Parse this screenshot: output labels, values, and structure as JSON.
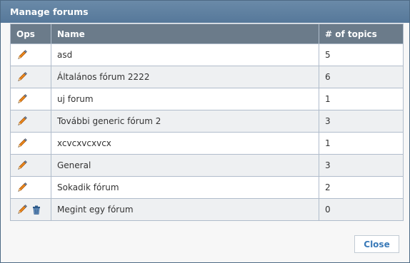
{
  "dialog": {
    "title": "Manage forums",
    "close_label": "Close"
  },
  "table": {
    "headers": [
      "Ops",
      "Name",
      "# of topics"
    ],
    "rows": [
      {
        "name": "asd",
        "topics": "5",
        "deletable": false
      },
      {
        "name": "Általános fórum 2222",
        "topics": "6",
        "deletable": false
      },
      {
        "name": "uj forum",
        "topics": "1",
        "deletable": false
      },
      {
        "name": "További generic fórum 2",
        "topics": "3",
        "deletable": false
      },
      {
        "name": "xcvcxvcxvcx",
        "topics": "1",
        "deletable": false
      },
      {
        "name": "General",
        "topics": "3",
        "deletable": false
      },
      {
        "name": "Sokadik fórum",
        "topics": "2",
        "deletable": false
      },
      {
        "name": "Megint egy fórum",
        "topics": "0",
        "deletable": true
      }
    ]
  },
  "icons": {
    "edit": "pencil-icon",
    "delete": "trash-icon"
  },
  "colors": {
    "titlebar": "#5f82a3",
    "header": "#6b7b8a",
    "close_text": "#3a7ab8"
  }
}
